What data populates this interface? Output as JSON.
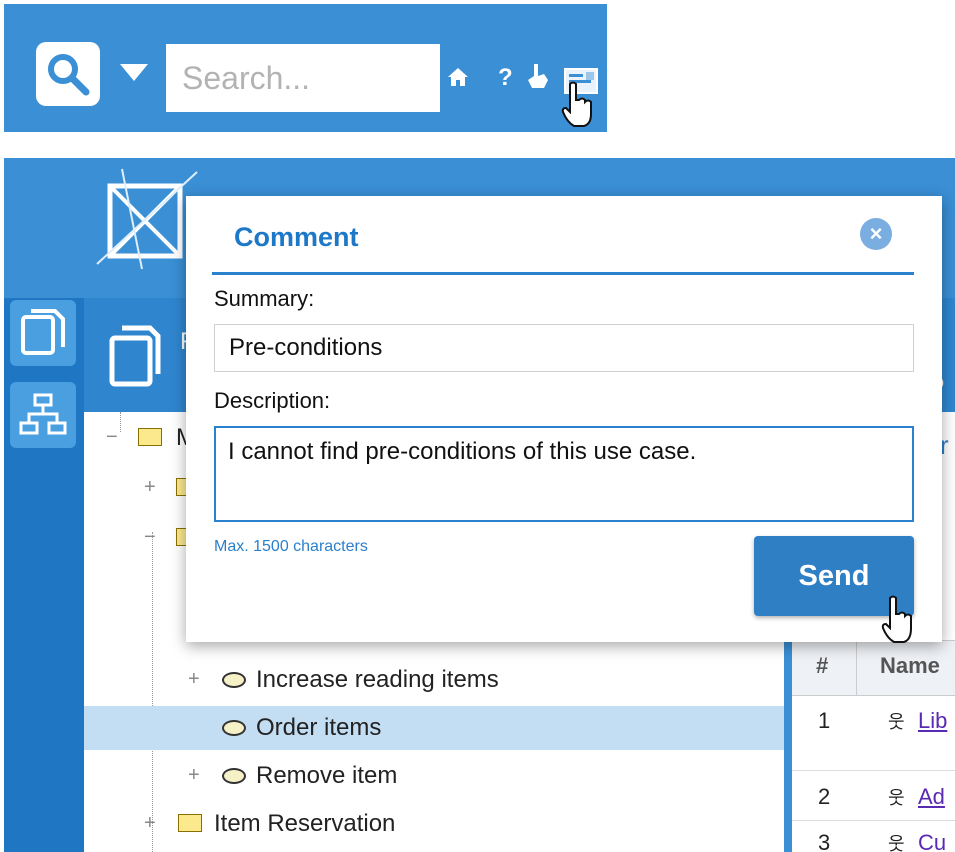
{
  "search": {
    "placeholder": "Search..."
  },
  "toolbar": {
    "help_glyph": "?"
  },
  "dialog": {
    "title": "Comment",
    "summary_label": "Summary:",
    "summary_value": "Pre-conditions",
    "description_label": "Description:",
    "description_value": "I cannot find pre-conditions of this use case.",
    "max_note": "Max. 1500 characters",
    "send_label": "Send"
  },
  "tree": {
    "root_label": "M",
    "items": [
      {
        "label": "Increase reading items",
        "type": "use-case",
        "selected": false
      },
      {
        "label": "Order items",
        "type": "use-case",
        "selected": true
      },
      {
        "label": "Remove item",
        "type": "use-case",
        "selected": false
      },
      {
        "label": "Item Reservation",
        "type": "package",
        "selected": false
      }
    ]
  },
  "panel": {
    "title_partial": "F",
    "side_text_1": "r",
    "side_text_2": "o"
  },
  "grid": {
    "columns": [
      "#",
      "Name"
    ],
    "rows": [
      {
        "num": "1",
        "name": "Lib"
      },
      {
        "num": "2",
        "name": "Ad"
      },
      {
        "num": "3",
        "name": "Cu"
      }
    ]
  },
  "colors": {
    "accent": "#3a8fd5",
    "dark_accent": "#1f76c2",
    "selection": "#c3ddf3",
    "link": "#5a2ab2"
  }
}
